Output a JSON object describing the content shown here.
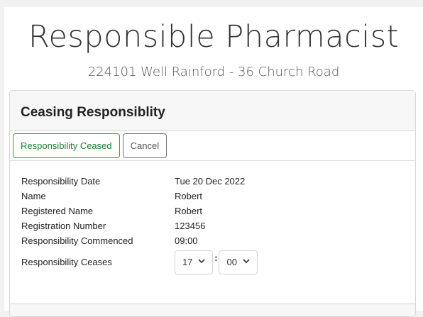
{
  "header": {
    "title": "Responsible Pharmacist",
    "subtitle": "224101 Well Rainford - 36 Church Road"
  },
  "card": {
    "title": "Ceasing Responsiblity"
  },
  "toolbar": {
    "ceased_label": "Responsibility Ceased",
    "cancel_label": "Cancel"
  },
  "details": {
    "rows": [
      {
        "label": "Responsibility Date",
        "value": "Tue 20 Dec 2022"
      },
      {
        "label": "Name",
        "value": "Robert"
      },
      {
        "label": "Registered Name",
        "value": "Robert"
      },
      {
        "label": "Registration Number",
        "value": "123456"
      },
      {
        "label": "Responsibility Commenced",
        "value": "09:00"
      }
    ],
    "ceases_label": "Responsibility Ceases",
    "ceases_hour": "17",
    "ceases_minute": "00",
    "separator": ":"
  },
  "colors": {
    "success": "#28a745",
    "secondary": "#6c757d"
  }
}
